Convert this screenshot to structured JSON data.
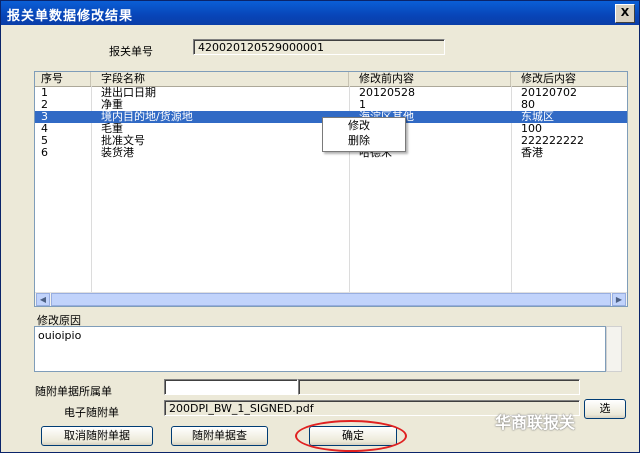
{
  "window": {
    "title": "报关单数据修改结果",
    "close_label": "X"
  },
  "declaration": {
    "label": "报关单号",
    "value": "420020120529000001"
  },
  "table": {
    "columns": [
      "序号",
      "字段名称",
      "修改前内容",
      "修改后内容"
    ],
    "rows": [
      [
        "1",
        "进出口日期",
        "20120528",
        "20120702"
      ],
      [
        "2",
        "净重",
        "1",
        "80"
      ],
      [
        "3",
        "境内目的地/货源地",
        "海淀区其他",
        "东城区"
      ],
      [
        "4",
        "毛重",
        "",
        "100"
      ],
      [
        "5",
        "批准文号",
        "11",
        "222222222"
      ],
      [
        "6",
        "装货港",
        "哈德米",
        "香港"
      ]
    ],
    "selected_row": 3
  },
  "context_menu": {
    "items": [
      "修改",
      "删除"
    ]
  },
  "reason": {
    "label": "修改原因",
    "value": "ouioipio"
  },
  "attachment": {
    "belong_label": "随附单据所属单",
    "belong_value": "",
    "edoc_label": "电子随附单",
    "edoc_value": "200DPI_BW_1_SIGNED.pdf",
    "select_label": "选"
  },
  "buttons": {
    "cancel": "取消随附单据",
    "query": "随附单据查",
    "ok": "确定"
  },
  "watermark": "华商联报关",
  "colors": {
    "titlebar": "#0845b8",
    "selection": "#316ac5",
    "highlight_ring": "#e02020"
  }
}
